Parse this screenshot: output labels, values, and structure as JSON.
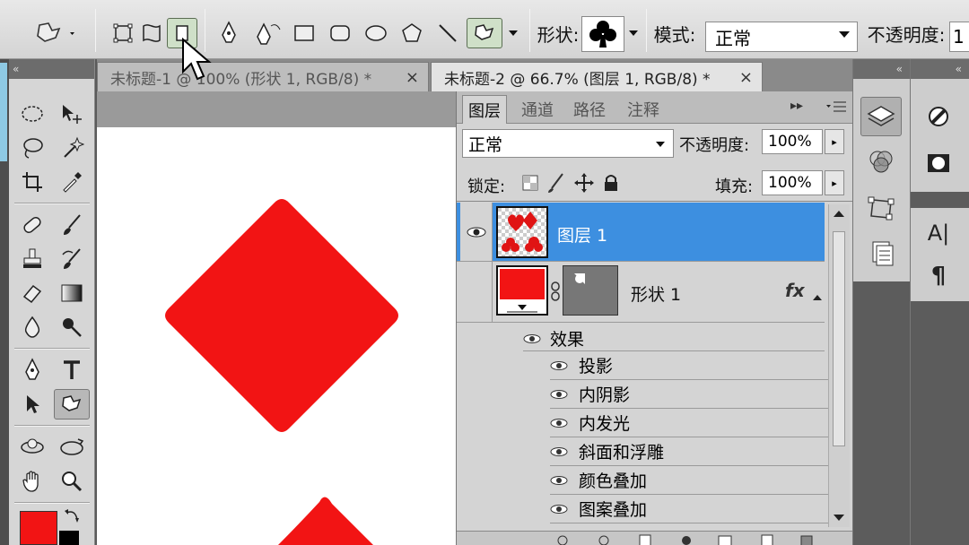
{
  "options_bar": {
    "shape_label": "形状:",
    "mode_label": "模式:",
    "mode_value": "正常",
    "opacity_label": "不透明度:",
    "opacity_value": "1"
  },
  "tabs": [
    {
      "label": "未标题-1 @ 100% (形状 1, RGB/8) *",
      "close": "×"
    },
    {
      "label": "未标题-2 @ 66.7% (图层 1, RGB/8) *",
      "close": "×"
    }
  ],
  "panel_collapse": "«",
  "layers_panel": {
    "tabs": [
      "图层",
      "通道",
      "路径",
      "注释"
    ],
    "menu_glyph": "▸▸",
    "blend_mode": "正常",
    "opacity_label": "不透明度:",
    "opacity_value": "100%",
    "lock_label": "锁定:",
    "fill_label": "填充:",
    "fill_value": "100%",
    "layers": [
      {
        "name": "图层 1",
        "selected": true
      },
      {
        "name": "形状 1",
        "selected": false,
        "fx": "fx"
      }
    ],
    "effects_label": "效果",
    "effects": [
      "投影",
      "内阴影",
      "内发光",
      "斜面和浮雕",
      "颜色叠加",
      "图案叠加"
    ]
  },
  "dock": {
    "text_glyph": "A|",
    "para_glyph": "¶"
  },
  "colors": {
    "accent_red": "#f21414",
    "selection_blue": "#3d8fe0"
  }
}
